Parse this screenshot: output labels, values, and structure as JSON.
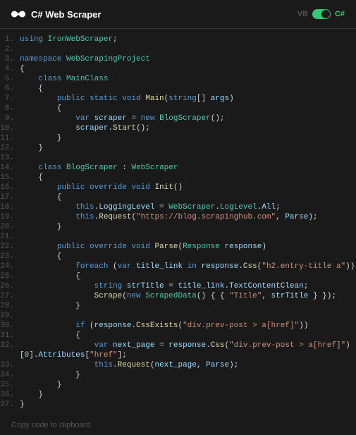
{
  "header": {
    "title": "C# Web Scraper",
    "lang_left": "VB",
    "lang_right": "C#"
  },
  "footer": {
    "copy_label": "Copy code to clipboard"
  },
  "code": {
    "lines": [
      {
        "n": "1",
        "t": [
          {
            "c": "k-blue",
            "s": "using"
          },
          {
            "c": "k-pun",
            "s": " "
          },
          {
            "c": "k-teal",
            "s": "IronWebScraper"
          },
          {
            "c": "k-pun",
            "s": ";"
          }
        ]
      },
      {
        "n": "2",
        "t": []
      },
      {
        "n": "3",
        "t": [
          {
            "c": "k-blue",
            "s": "namespace"
          },
          {
            "c": "k-pun",
            "s": " "
          },
          {
            "c": "k-teal",
            "s": "WebScrapingProject"
          }
        ]
      },
      {
        "n": "4",
        "t": [
          {
            "c": "k-pun",
            "s": "{"
          }
        ]
      },
      {
        "n": "5",
        "t": [
          {
            "c": "k-pun",
            "s": "    "
          },
          {
            "c": "k-blue",
            "s": "class"
          },
          {
            "c": "k-pun",
            "s": " "
          },
          {
            "c": "k-teal",
            "s": "MainClass"
          }
        ]
      },
      {
        "n": "6",
        "t": [
          {
            "c": "k-pun",
            "s": "    {"
          }
        ]
      },
      {
        "n": "7",
        "t": [
          {
            "c": "k-pun",
            "s": "        "
          },
          {
            "c": "k-blue",
            "s": "public static void"
          },
          {
            "c": "k-pun",
            "s": " "
          },
          {
            "c": "k-yellow",
            "s": "Main"
          },
          {
            "c": "k-pun",
            "s": "("
          },
          {
            "c": "k-blue",
            "s": "string"
          },
          {
            "c": "k-pun",
            "s": "[] "
          },
          {
            "c": "k-id",
            "s": "args"
          },
          {
            "c": "k-pun",
            "s": ")"
          }
        ]
      },
      {
        "n": "8",
        "t": [
          {
            "c": "k-pun",
            "s": "        {"
          }
        ]
      },
      {
        "n": "9",
        "t": [
          {
            "c": "k-pun",
            "s": "            "
          },
          {
            "c": "k-blue",
            "s": "var"
          },
          {
            "c": "k-pun",
            "s": " "
          },
          {
            "c": "k-id",
            "s": "scraper"
          },
          {
            "c": "k-pun",
            "s": " = "
          },
          {
            "c": "k-blue",
            "s": "new"
          },
          {
            "c": "k-pun",
            "s": " "
          },
          {
            "c": "k-teal",
            "s": "BlogScraper"
          },
          {
            "c": "k-pun",
            "s": "();"
          }
        ]
      },
      {
        "n": "10",
        "t": [
          {
            "c": "k-pun",
            "s": "            "
          },
          {
            "c": "k-id",
            "s": "scraper"
          },
          {
            "c": "k-pun",
            "s": "."
          },
          {
            "c": "k-yellow",
            "s": "Start"
          },
          {
            "c": "k-pun",
            "s": "();"
          }
        ]
      },
      {
        "n": "11",
        "t": [
          {
            "c": "k-pun",
            "s": "        }"
          }
        ]
      },
      {
        "n": "12",
        "t": [
          {
            "c": "k-pun",
            "s": "    }"
          }
        ]
      },
      {
        "n": "13",
        "t": []
      },
      {
        "n": "14",
        "t": [
          {
            "c": "k-pun",
            "s": "    "
          },
          {
            "c": "k-blue",
            "s": "class"
          },
          {
            "c": "k-pun",
            "s": " "
          },
          {
            "c": "k-teal",
            "s": "BlogScraper"
          },
          {
            "c": "k-pun",
            "s": " : "
          },
          {
            "c": "k-teal",
            "s": "WebScraper"
          }
        ]
      },
      {
        "n": "15",
        "t": [
          {
            "c": "k-pun",
            "s": "    {"
          }
        ]
      },
      {
        "n": "16",
        "t": [
          {
            "c": "k-pun",
            "s": "        "
          },
          {
            "c": "k-blue",
            "s": "public override void"
          },
          {
            "c": "k-pun",
            "s": " "
          },
          {
            "c": "k-yellow",
            "s": "Init"
          },
          {
            "c": "k-pun",
            "s": "()"
          }
        ]
      },
      {
        "n": "17",
        "t": [
          {
            "c": "k-pun",
            "s": "        {"
          }
        ]
      },
      {
        "n": "18",
        "t": [
          {
            "c": "k-pun",
            "s": "            "
          },
          {
            "c": "k-blue",
            "s": "this"
          },
          {
            "c": "k-pun",
            "s": "."
          },
          {
            "c": "k-id",
            "s": "LoggingLevel"
          },
          {
            "c": "k-pun",
            "s": " = "
          },
          {
            "c": "k-teal",
            "s": "WebScraper"
          },
          {
            "c": "k-pun",
            "s": "."
          },
          {
            "c": "k-teal",
            "s": "LogLevel"
          },
          {
            "c": "k-pun",
            "s": "."
          },
          {
            "c": "k-id",
            "s": "All"
          },
          {
            "c": "k-pun",
            "s": ";"
          }
        ]
      },
      {
        "n": "19",
        "t": [
          {
            "c": "k-pun",
            "s": "            "
          },
          {
            "c": "k-blue",
            "s": "this"
          },
          {
            "c": "k-pun",
            "s": "."
          },
          {
            "c": "k-yellow",
            "s": "Request"
          },
          {
            "c": "k-pun",
            "s": "("
          },
          {
            "c": "k-str",
            "s": "\"https://blog.scrapinghub.com\""
          },
          {
            "c": "k-pun",
            "s": ", "
          },
          {
            "c": "k-id",
            "s": "Parse"
          },
          {
            "c": "k-pun",
            "s": ");"
          }
        ]
      },
      {
        "n": "20",
        "t": [
          {
            "c": "k-pun",
            "s": "        }"
          }
        ]
      },
      {
        "n": "21",
        "t": []
      },
      {
        "n": "22",
        "t": [
          {
            "c": "k-pun",
            "s": "        "
          },
          {
            "c": "k-blue",
            "s": "public override void"
          },
          {
            "c": "k-pun",
            "s": " "
          },
          {
            "c": "k-yellow",
            "s": "Parse"
          },
          {
            "c": "k-pun",
            "s": "("
          },
          {
            "c": "k-teal",
            "s": "Response"
          },
          {
            "c": "k-pun",
            "s": " "
          },
          {
            "c": "k-id",
            "s": "response"
          },
          {
            "c": "k-pun",
            "s": ")"
          }
        ]
      },
      {
        "n": "23",
        "t": [
          {
            "c": "k-pun",
            "s": "        {"
          }
        ]
      },
      {
        "n": "24",
        "t": [
          {
            "c": "k-pun",
            "s": "            "
          },
          {
            "c": "k-blue",
            "s": "foreach"
          },
          {
            "c": "k-pun",
            "s": " ("
          },
          {
            "c": "k-blue",
            "s": "var"
          },
          {
            "c": "k-pun",
            "s": " "
          },
          {
            "c": "k-id",
            "s": "title_link"
          },
          {
            "c": "k-pun",
            "s": " "
          },
          {
            "c": "k-blue",
            "s": "in"
          },
          {
            "c": "k-pun",
            "s": " "
          },
          {
            "c": "k-id",
            "s": "response"
          },
          {
            "c": "k-pun",
            "s": "."
          },
          {
            "c": "k-yellow",
            "s": "Css"
          },
          {
            "c": "k-pun",
            "s": "("
          },
          {
            "c": "k-str",
            "s": "\"h2.entry-title a\""
          },
          {
            "c": "k-pun",
            "s": "))"
          }
        ]
      },
      {
        "n": "25",
        "t": [
          {
            "c": "k-pun",
            "s": "            {"
          }
        ]
      },
      {
        "n": "26",
        "t": [
          {
            "c": "k-pun",
            "s": "                "
          },
          {
            "c": "k-blue",
            "s": "string"
          },
          {
            "c": "k-pun",
            "s": " "
          },
          {
            "c": "k-id",
            "s": "strTitle"
          },
          {
            "c": "k-pun",
            "s": " = "
          },
          {
            "c": "k-id",
            "s": "title_link"
          },
          {
            "c": "k-pun",
            "s": "."
          },
          {
            "c": "k-id",
            "s": "TextContentClean"
          },
          {
            "c": "k-pun",
            "s": ";"
          }
        ]
      },
      {
        "n": "27",
        "t": [
          {
            "c": "k-pun",
            "s": "                "
          },
          {
            "c": "k-yellow",
            "s": "Scrape"
          },
          {
            "c": "k-pun",
            "s": "("
          },
          {
            "c": "k-blue",
            "s": "new"
          },
          {
            "c": "k-pun",
            "s": " "
          },
          {
            "c": "k-teal",
            "s": "ScrapedData"
          },
          {
            "c": "k-pun",
            "s": "() { { "
          },
          {
            "c": "k-str",
            "s": "\"Title\""
          },
          {
            "c": "k-pun",
            "s": ", "
          },
          {
            "c": "k-id",
            "s": "strTitle"
          },
          {
            "c": "k-pun",
            "s": " } });"
          }
        ]
      },
      {
        "n": "28",
        "t": [
          {
            "c": "k-pun",
            "s": "            }"
          }
        ]
      },
      {
        "n": "29",
        "t": []
      },
      {
        "n": "30",
        "t": [
          {
            "c": "k-pun",
            "s": "            "
          },
          {
            "c": "k-blue",
            "s": "if"
          },
          {
            "c": "k-pun",
            "s": " ("
          },
          {
            "c": "k-id",
            "s": "response"
          },
          {
            "c": "k-pun",
            "s": "."
          },
          {
            "c": "k-yellow",
            "s": "CssExists"
          },
          {
            "c": "k-pun",
            "s": "("
          },
          {
            "c": "k-str",
            "s": "\"div.prev-post > a[href]\""
          },
          {
            "c": "k-pun",
            "s": "))"
          }
        ]
      },
      {
        "n": "31",
        "t": [
          {
            "c": "k-pun",
            "s": "            {"
          }
        ]
      },
      {
        "n": "32",
        "t": [
          {
            "c": "k-pun",
            "s": "                "
          },
          {
            "c": "k-blue",
            "s": "var"
          },
          {
            "c": "k-pun",
            "s": " "
          },
          {
            "c": "k-id",
            "s": "next_page"
          },
          {
            "c": "k-pun",
            "s": " = "
          },
          {
            "c": "k-id",
            "s": "response"
          },
          {
            "c": "k-pun",
            "s": "."
          },
          {
            "c": "k-yellow",
            "s": "Css"
          },
          {
            "c": "k-pun",
            "s": "("
          },
          {
            "c": "k-str",
            "s": "\"div.prev-post > a[href]\""
          },
          {
            "c": "k-pun",
            "s": ")"
          }
        ]
      },
      {
        "n": "32b",
        "wrap": true,
        "t": [
          {
            "c": "k-pun",
            "s": "["
          },
          {
            "c": "k-num",
            "s": "0"
          },
          {
            "c": "k-pun",
            "s": "]."
          },
          {
            "c": "k-id",
            "s": "Attributes"
          },
          {
            "c": "k-pun",
            "s": "["
          },
          {
            "c": "k-str",
            "s": "\"href\""
          },
          {
            "c": "k-pun",
            "s": "];"
          }
        ]
      },
      {
        "n": "33",
        "t": [
          {
            "c": "k-pun",
            "s": "                "
          },
          {
            "c": "k-blue",
            "s": "this"
          },
          {
            "c": "k-pun",
            "s": "."
          },
          {
            "c": "k-yellow",
            "s": "Request"
          },
          {
            "c": "k-pun",
            "s": "("
          },
          {
            "c": "k-id",
            "s": "next_page"
          },
          {
            "c": "k-pun",
            "s": ", "
          },
          {
            "c": "k-id",
            "s": "Parse"
          },
          {
            "c": "k-pun",
            "s": ");"
          }
        ]
      },
      {
        "n": "34",
        "t": [
          {
            "c": "k-pun",
            "s": "            }"
          }
        ]
      },
      {
        "n": "35",
        "t": [
          {
            "c": "k-pun",
            "s": "        }"
          }
        ]
      },
      {
        "n": "36",
        "t": [
          {
            "c": "k-pun",
            "s": "    }"
          }
        ]
      },
      {
        "n": "37",
        "t": [
          {
            "c": "k-pun",
            "s": "}"
          }
        ]
      }
    ]
  }
}
